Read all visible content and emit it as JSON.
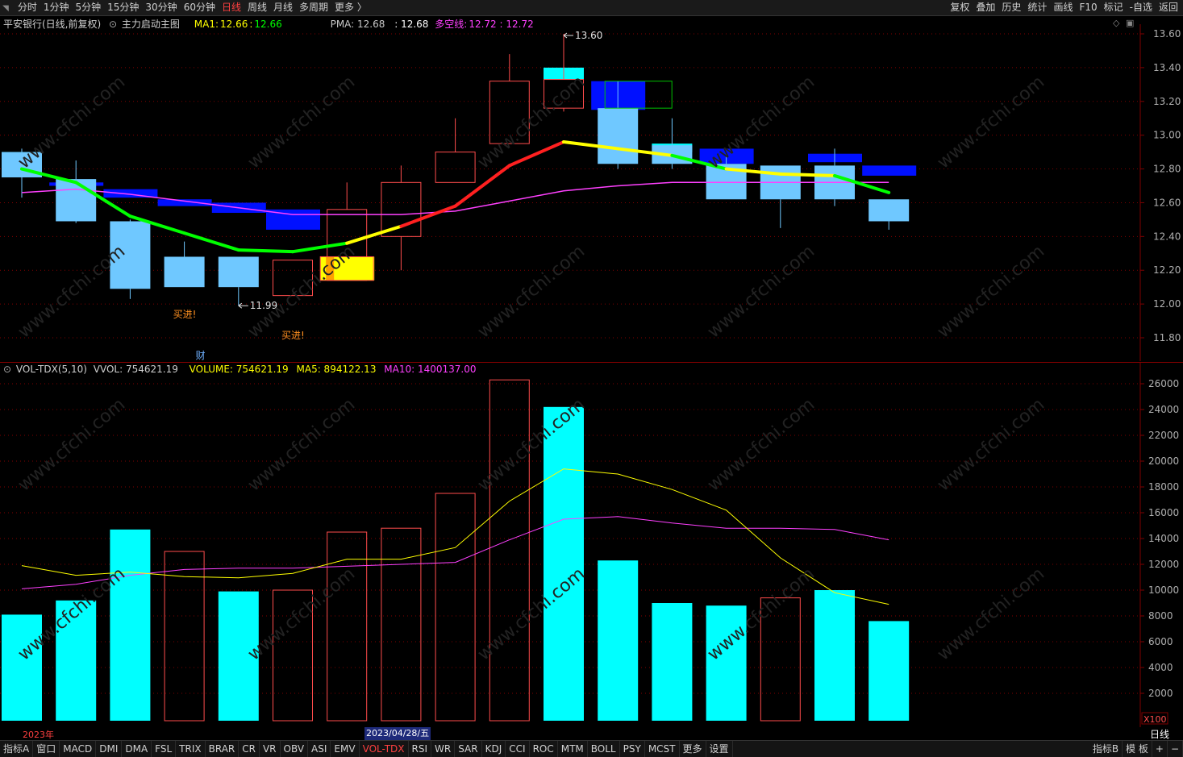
{
  "toolbar": {
    "periods": [
      "分时",
      "1分钟",
      "5分钟",
      "15分钟",
      "30分钟",
      "60分钟",
      "日线",
      "周线",
      "月线",
      "多周期",
      "更多 〉"
    ],
    "active_period": "日线",
    "right_items": [
      "复权",
      "叠加",
      "历史",
      "统计",
      "画线",
      "F10",
      "标记",
      "-自选",
      "返回"
    ]
  },
  "main_header": {
    "stock": "平安银行(日线,前复权)",
    "indicator": "主力启动主图",
    "ma1_label": "MA1:",
    "ma1_v1": "12.66",
    "ma1_v2": "12.66",
    "pma_label": "PMA: 12.68",
    "pma_v2": ": 12.68",
    "dk_label": "多空线:",
    "dk_value": "12.72 : 12.72"
  },
  "vol_header": {
    "name": "VOL-TDX(5,10)",
    "vvol": "VVOL: 754621.19",
    "volume": "VOLUME: 754621.19",
    "ma5": "MA5: 894122.13",
    "ma10": "MA10: 1400137.00"
  },
  "annotations": {
    "high": "13.60",
    "low": "11.99",
    "buy1": "买进!",
    "buy2": "买进!",
    "fin": "财"
  },
  "price_axis": {
    "ticks": [
      "13.60",
      "13.40",
      "13.20",
      "13.00",
      "12.80",
      "12.60",
      "12.40",
      "12.20",
      "12.00",
      "11.80"
    ]
  },
  "vol_axis": {
    "ticks": [
      "26000",
      "24000",
      "22000",
      "20000",
      "18000",
      "16000",
      "14000",
      "12000",
      "10000",
      "8000",
      "6000",
      "4000",
      "2000"
    ],
    "unit": "X100"
  },
  "date_bar": {
    "year": "2023年",
    "cursor_date": "2023/04/28/五",
    "period": "日线"
  },
  "tabs": [
    "指标A",
    "窗口",
    "MACD",
    "DMI",
    "DMA",
    "FSL",
    "TRIX",
    "BRAR",
    "CR",
    "VR",
    "OBV",
    "ASI",
    "EMV",
    "VOL-TDX",
    "RSI",
    "WR",
    "SAR",
    "KDJ",
    "CCI",
    "ROC",
    "MTM",
    "BOLL",
    "PSY",
    "MCST",
    "更多",
    "设置"
  ],
  "active_tab": "VOL-TDX",
  "tab_right": [
    "指标B",
    "模 板",
    "+",
    "−"
  ],
  "colors": {
    "up": "#ff4c4c",
    "down": "#6fc8ff",
    "vol_down": "#00ffff",
    "ma_yellow": "#ffff00",
    "ma_green": "#00ff00",
    "pma": "#ff40ff",
    "dk_blue": "#0010ff",
    "grid": "#800000",
    "axis_text": "#b0b0b0"
  },
  "chart_data": {
    "type": "candlestick",
    "ylim": [
      11.75,
      13.68
    ],
    "candles": [
      {
        "o": 12.9,
        "h": 12.92,
        "l": 12.63,
        "c": 12.75,
        "dk": [
          12.9,
          12.8
        ],
        "dk_color": "cyan"
      },
      {
        "o": 12.74,
        "h": 12.85,
        "l": 12.48,
        "c": 12.49,
        "dk": [
          12.72,
          12.7
        ],
        "dk_color": "blue"
      },
      {
        "o": 12.49,
        "h": 12.5,
        "l": 12.03,
        "c": 12.09,
        "dk": [
          12.68,
          12.63
        ],
        "dk_color": "blue"
      },
      {
        "o": 12.28,
        "h": 12.37,
        "l": 12.1,
        "c": 12.1,
        "dk": [
          12.62,
          12.58
        ],
        "dk_color": "blue"
      },
      {
        "o": 12.28,
        "h": 12.28,
        "l": 11.99,
        "c": 12.1,
        "dk": [
          12.6,
          12.54
        ],
        "dk_color": "blue"
      },
      {
        "o": 12.05,
        "h": 12.26,
        "l": 12.05,
        "c": 12.26,
        "dk": [
          12.56,
          12.44
        ],
        "dk_color": "blue"
      },
      {
        "o": 12.14,
        "h": 12.72,
        "l": 12.14,
        "c": 12.56,
        "dk": [
          12.28,
          12.14
        ],
        "dk_color": "yellow"
      },
      {
        "o": 12.4,
        "h": 12.82,
        "l": 12.2,
        "c": 12.72,
        "dk": [
          12.56,
          12.52
        ],
        "dk_color": "none"
      },
      {
        "o": 12.72,
        "h": 13.1,
        "l": 12.72,
        "c": 12.9,
        "dk": [
          12.9,
          12.84
        ],
        "dk_color": "none"
      },
      {
        "o": 12.95,
        "h": 13.48,
        "l": 12.95,
        "c": 13.32,
        "dk": [
          13.32,
          13.3
        ],
        "dk_color": "none"
      },
      {
        "o": 13.16,
        "h": 13.6,
        "l": 13.14,
        "c": 13.33,
        "dk": [
          13.4,
          13.33
        ],
        "dk_color": "cyan"
      },
      {
        "o": 13.16,
        "h": 13.32,
        "l": 12.8,
        "c": 12.83,
        "dk": [
          13.32,
          13.15
        ],
        "dk_color": "blue"
      },
      {
        "o": 12.94,
        "h": 13.1,
        "l": 12.8,
        "c": 12.83,
        "dk": [
          12.95,
          12.9
        ],
        "dk_color": "cyan"
      },
      {
        "o": 12.83,
        "h": 12.88,
        "l": 12.62,
        "c": 12.62,
        "dk": [
          12.92,
          12.83
        ],
        "dk_color": "blue"
      },
      {
        "o": 12.82,
        "h": 12.82,
        "l": 12.45,
        "c": 12.62,
        "dk": [
          12.82,
          12.78
        ],
        "dk_color": "none"
      },
      {
        "o": 12.82,
        "h": 12.92,
        "l": 12.58,
        "c": 12.62,
        "dk": [
          12.89,
          12.84
        ],
        "dk_color": "blue"
      },
      {
        "o": 12.62,
        "h": 12.62,
        "l": 12.44,
        "c": 12.49,
        "dk": [
          12.82,
          12.76
        ],
        "dk_color": "blue"
      }
    ],
    "ma1": [
      12.8,
      12.72,
      12.52,
      12.42,
      12.32,
      12.31,
      12.36,
      12.46,
      12.58,
      12.82,
      12.96,
      12.92,
      12.88,
      12.8,
      12.77,
      12.76,
      12.66
    ],
    "ma1_colors": [
      "g",
      "g",
      "g",
      "g",
      "g",
      "g",
      "y",
      "r",
      "r",
      "r",
      "y",
      "y",
      "g",
      "y",
      "y",
      "g",
      "g"
    ],
    "pma": [
      12.66,
      12.68,
      12.65,
      12.61,
      12.57,
      12.53,
      12.53,
      12.53,
      12.55,
      12.61,
      12.67,
      12.7,
      12.72,
      12.72,
      12.72,
      12.72,
      12.72
    ],
    "volumes": [
      8100,
      9200,
      14700,
      13000,
      9900,
      10000,
      14500,
      14800,
      17500,
      26300,
      24200,
      12300,
      9000,
      8800,
      9400,
      10000,
      7600
    ],
    "vol_up": [
      false,
      false,
      false,
      true,
      false,
      true,
      true,
      true,
      true,
      true,
      false,
      false,
      false,
      false,
      true,
      false,
      false
    ],
    "vol_ma5": [
      11900,
      11150,
      11400,
      11050,
      10950,
      11300,
      12400,
      12400,
      13300,
      16900,
      19400,
      19000,
      17800,
      16200,
      12500,
      9800,
      8900
    ],
    "vol_ma10": [
      10100,
      10450,
      11150,
      11600,
      11700,
      11700,
      11850,
      12000,
      12150,
      13900,
      15500,
      15700,
      15200,
      14800,
      14800,
      14700,
      13900
    ],
    "vol_ylim": [
      0,
      27000
    ]
  }
}
